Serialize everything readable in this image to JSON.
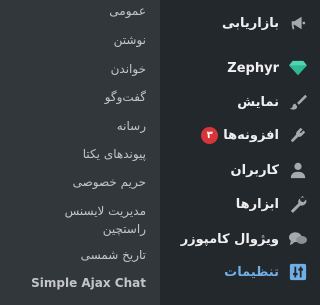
{
  "main_menu": {
    "items": [
      {
        "label": "بازاریابی",
        "icon": "megaphone-icon"
      },
      {
        "label": "Zephyr",
        "icon": "diamond-icon"
      },
      {
        "label": "نمایش",
        "icon": "paintbrush-icon"
      },
      {
        "label": "افزونه‌ها",
        "icon": "plugin-icon",
        "badge": "۳"
      },
      {
        "label": "کاربران",
        "icon": "user-icon"
      },
      {
        "label": "ابزارها",
        "icon": "wrench-icon"
      },
      {
        "label": "ویژوال کامپوزر",
        "icon": "chat-bubbles-icon"
      },
      {
        "label": "تنظیمات",
        "icon": "settings-sliders-icon",
        "current": true
      }
    ]
  },
  "settings_submenu": {
    "items": [
      {
        "label": "عمومی"
      },
      {
        "label": "نوشتن"
      },
      {
        "label": "خواندن"
      },
      {
        "label": "گفت‌وگو"
      },
      {
        "label": "رسانه"
      },
      {
        "label": "پیوندهای یکتا"
      },
      {
        "label": "حریم خصوصی"
      },
      {
        "label": "مدیریت لایسنس راستچین"
      },
      {
        "label": "تاریخ شمسی"
      },
      {
        "label": "Simple Ajax Chat"
      }
    ]
  },
  "colors": {
    "menu_bg": "#23282d",
    "submenu_bg": "#32373c",
    "current": "#72aee6",
    "badge": "#d63638",
    "zephyr_icon": "#4fd6b0"
  }
}
